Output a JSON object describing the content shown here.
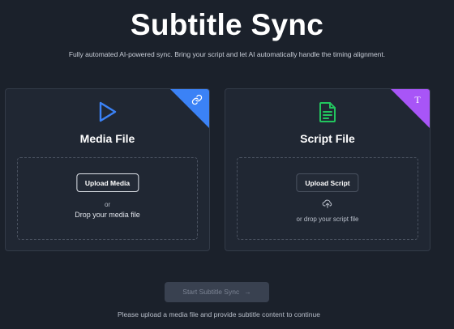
{
  "header": {
    "title": "Subtitle Sync",
    "subtitle": "Fully automated AI-powered sync. Bring your script and let AI automatically handle the timing alignment."
  },
  "media_card": {
    "title": "Media File",
    "icon": "play-icon",
    "corner_icon": "link-icon",
    "corner_color": "#3b82f6",
    "upload_label": "Upload Media",
    "or_text": "or",
    "drop_text": "Drop your media file"
  },
  "script_card": {
    "title": "Script File",
    "icon": "document-icon",
    "corner_icon": "text-t-icon",
    "corner_glyph": "T",
    "corner_color": "#a855f7",
    "upload_label": "Upload Script",
    "drop_text": "or drop your script file"
  },
  "footer": {
    "start_label": "Start Subtitle Sync",
    "start_arrow": "→",
    "hint": "Please upload a media file and provide subtitle content to continue"
  },
  "colors": {
    "background": "#1b212b",
    "card": "#202733",
    "media_accent": "#3b82f6",
    "script_accent": "#22c55e"
  }
}
